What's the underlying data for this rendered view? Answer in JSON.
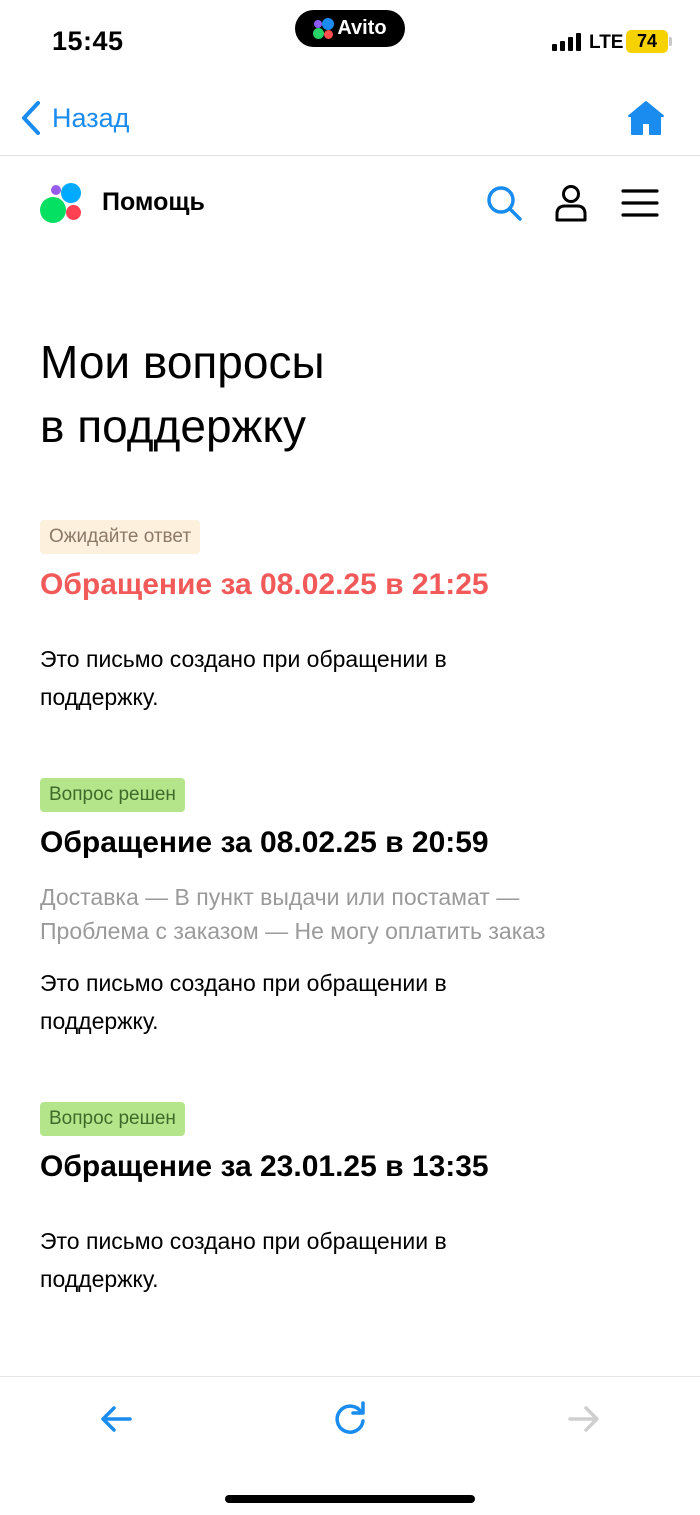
{
  "status_bar": {
    "time": "15:45",
    "app_name": "Avito",
    "network": "LTE",
    "battery": "74"
  },
  "nav": {
    "back_label": "Назад"
  },
  "header": {
    "title": "Помощь"
  },
  "page": {
    "title_line1": "Мои вопросы",
    "title_line2": "в поддержку"
  },
  "tickets": [
    {
      "badge": "Ожидайте ответ",
      "title": "Обращение за 08.02.25 в 21:25",
      "body_line1": "Это письмо создано при обращении в",
      "body_line2": "поддержку."
    },
    {
      "badge": "Вопрос решен",
      "title": "Обращение за 08.02.25 в 20:59",
      "category_line1": "Доставка — В пункт выдачи или постамат —",
      "category_line2": "Проблема с заказом — Не могу оплатить заказ",
      "body_line1": "Это письмо создано при обращении в",
      "body_line2": "поддержку."
    },
    {
      "badge": "Вопрос решен",
      "title": "Обращение за 23.01.25 в 13:35",
      "body_line1": "Это письмо создано при обращении в",
      "body_line2": "поддержку."
    }
  ],
  "colors": {
    "accent": "#1a8cf0",
    "pending_title": "#f25a5a",
    "pending_badge_bg": "#fdf0dc",
    "resolved_badge_bg": "#b4e58a",
    "muted_text": "#9a9a9a"
  },
  "icons": {
    "back": "chevron-left-icon",
    "home": "home-icon",
    "search": "search-icon",
    "profile": "user-icon",
    "menu": "hamburger-menu-icon",
    "toolbar_back": "arrow-left-icon",
    "toolbar_reload": "reload-icon",
    "toolbar_forward": "arrow-right-icon"
  }
}
